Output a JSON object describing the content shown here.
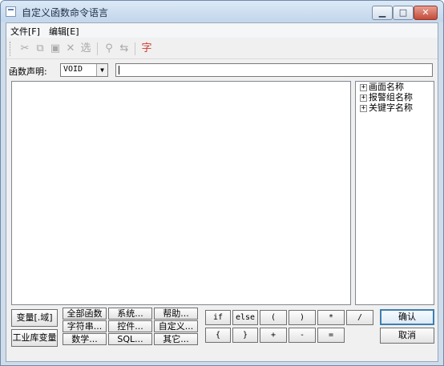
{
  "window": {
    "title": "自定义函数命令语言",
    "controls": {
      "minimize": "▁",
      "maximize": "□",
      "close": "✕"
    }
  },
  "menu": {
    "file": "文件[F]",
    "edit": "编辑[E]"
  },
  "toolbar": {
    "cut": "✂",
    "copy": "⧉",
    "paste": "▣",
    "delete": "✕",
    "select": "选",
    "find": "⚲",
    "replace": "⇆",
    "font": "字"
  },
  "declaration": {
    "label": "函数声明:",
    "return_type": "VOID",
    "signature": ""
  },
  "tree": {
    "items": [
      {
        "expander": "+",
        "label": "画面名称"
      },
      {
        "expander": "+",
        "label": "报警组名称"
      },
      {
        "expander": "+",
        "label": "关键字名称"
      }
    ]
  },
  "buttons": {
    "variables": "变量[.域]",
    "library_variables": "工业库变量",
    "all_functions": "全部函数",
    "system": "系统...",
    "help": "帮助...",
    "string": "字符串...",
    "controls": "控件...",
    "custom": "自定义...",
    "math": "数学...",
    "sql": "SQL...",
    "other": "其它...",
    "ok": "确认",
    "cancel": "取消"
  },
  "keywords": {
    "if": "if",
    "else": "else",
    "lparen": "(",
    "rparen": ")",
    "star": "*",
    "slash": "/",
    "lbrace": "{",
    "rbrace": "}",
    "plus": "+",
    "minus": "-",
    "equals": "="
  },
  "colors": {
    "font_tool_accent": "#d53a2e",
    "default_button_border": "#3c7fb1"
  }
}
